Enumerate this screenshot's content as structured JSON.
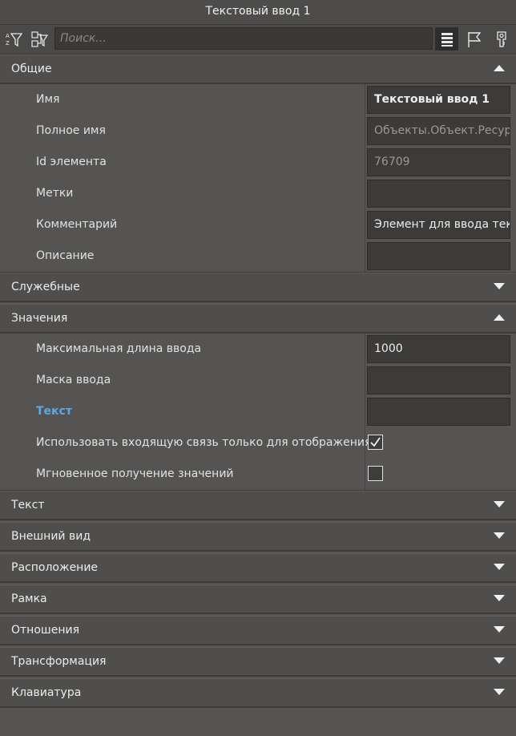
{
  "window": {
    "title": "Текстовый ввод 1"
  },
  "toolbar": {
    "search_placeholder": "Поиск...",
    "buttons": [
      "sort-filter-icon",
      "link-filter-icon",
      "list-view-icon",
      "flag-icon",
      "key-icon"
    ]
  },
  "sections": {
    "general": {
      "title": "Общие",
      "expanded": true,
      "rows": [
        {
          "label": "Имя",
          "value": "Текстовый ввод 1"
        },
        {
          "label": "Полное имя",
          "value": "Объекты.Объект.Ресурсы"
        },
        {
          "label": "Id элемента",
          "value": "76709"
        },
        {
          "label": "Метки",
          "value": ""
        },
        {
          "label": "Комментарий",
          "value": "Элемент для ввода текста"
        },
        {
          "label": "Описание",
          "value": ""
        }
      ]
    },
    "service": {
      "title": "Служебные",
      "expanded": false
    },
    "values": {
      "title": "Значения",
      "expanded": true,
      "rows": [
        {
          "label": "Максимальная длина ввода",
          "value": "1000"
        },
        {
          "label": "Маска ввода",
          "value": ""
        },
        {
          "label": "Текст",
          "value": ""
        },
        {
          "label": "Использовать входящую связь только для отображения",
          "checked": true
        },
        {
          "label": "Мгновенное получение значений",
          "checked": false
        }
      ]
    },
    "text": {
      "title": "Текст",
      "expanded": false
    },
    "appearance": {
      "title": "Внешний вид",
      "expanded": false
    },
    "position": {
      "title": "Расположение",
      "expanded": false
    },
    "frame": {
      "title": "Рамка",
      "expanded": false
    },
    "relations": {
      "title": "Отношения",
      "expanded": false
    },
    "transform": {
      "title": "Трансформация",
      "expanded": false
    },
    "keyboard": {
      "title": "Клавиатура",
      "expanded": false
    }
  },
  "colors": {
    "background": "#555452",
    "header": "#4f4e4c",
    "field": "#3c3b39",
    "accent_label": "#5ea8e0"
  }
}
